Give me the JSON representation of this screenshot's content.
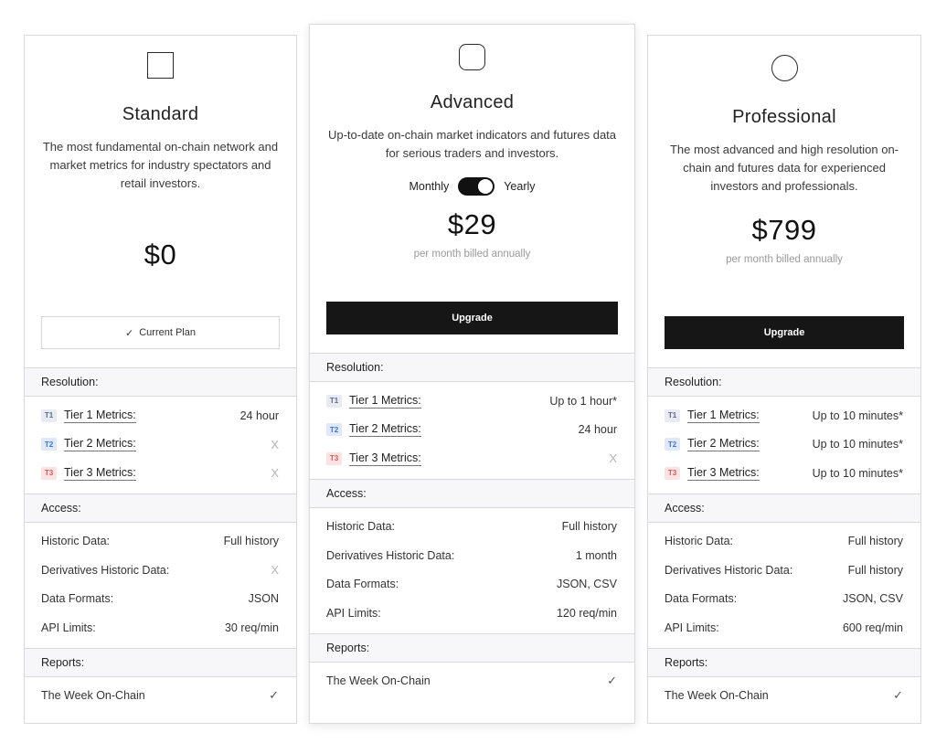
{
  "plans": [
    {
      "name": "Standard",
      "icon": "square-icon",
      "description": "The most fundamental on-chain network and market metrics for industry spectators and retail investors.",
      "price": "$0",
      "cta_check": "✓",
      "cta_label": "Current Plan",
      "resolution_label": "Resolution:",
      "tiers": [
        {
          "badge": "T1",
          "name": "Tier 1 Metrics:",
          "value": "24 hour"
        },
        {
          "badge": "T2",
          "name": "Tier 2 Metrics:",
          "value": "X"
        },
        {
          "badge": "T3",
          "name": "Tier 3 Metrics:",
          "value": "X"
        }
      ],
      "access_label": "Access:",
      "access": [
        {
          "name": "Historic Data:",
          "value": "Full history"
        },
        {
          "name": "Derivatives Historic Data:",
          "value": "X"
        },
        {
          "name": "Data Formats:",
          "value": "JSON"
        },
        {
          "name": "API Limits:",
          "value": "30 req/min"
        }
      ],
      "reports_label": "Reports:",
      "reports": [
        {
          "name": "The Week On-Chain",
          "value": "✓"
        }
      ]
    },
    {
      "name": "Advanced",
      "icon": "rounded-square-icon",
      "description": "Up-to-date on-chain market indicators and futures data for serious traders and investors.",
      "toggle_left": "Monthly",
      "toggle_right": "Yearly",
      "toggle_state": "Yearly",
      "price": "$29",
      "billing": "per month billed annually",
      "cta_label": "Upgrade",
      "resolution_label": "Resolution:",
      "tiers": [
        {
          "badge": "T1",
          "name": "Tier 1 Metrics:",
          "value": "Up to 1 hour*"
        },
        {
          "badge": "T2",
          "name": "Tier 2 Metrics:",
          "value": "24 hour"
        },
        {
          "badge": "T3",
          "name": "Tier 3 Metrics:",
          "value": "X"
        }
      ],
      "access_label": "Access:",
      "access": [
        {
          "name": "Historic Data:",
          "value": "Full history"
        },
        {
          "name": "Derivatives Historic Data:",
          "value": "1 month"
        },
        {
          "name": "Data Formats:",
          "value": "JSON, CSV"
        },
        {
          "name": "API Limits:",
          "value": "120 req/min"
        }
      ],
      "reports_label": "Reports:",
      "reports": [
        {
          "name": "The Week On-Chain",
          "value": "✓"
        }
      ]
    },
    {
      "name": "Professional",
      "icon": "circle-icon",
      "description": "The most advanced and high resolution on-chain and futures data for experienced investors and professionals.",
      "price": "$799",
      "billing": "per month billed annually",
      "cta_label": "Upgrade",
      "resolution_label": "Resolution:",
      "tiers": [
        {
          "badge": "T1",
          "name": "Tier 1 Metrics:",
          "value": "Up to 10 minutes*"
        },
        {
          "badge": "T2",
          "name": "Tier 2 Metrics:",
          "value": "Up to 10 minutes*"
        },
        {
          "badge": "T3",
          "name": "Tier 3 Metrics:",
          "value": "Up to 10 minutes*"
        }
      ],
      "access_label": "Access:",
      "access": [
        {
          "name": "Historic Data:",
          "value": "Full history"
        },
        {
          "name": "Derivatives Historic Data:",
          "value": "Full history"
        },
        {
          "name": "Data Formats:",
          "value": "JSON, CSV"
        },
        {
          "name": "API Limits:",
          "value": "600 req/min"
        }
      ],
      "reports_label": "Reports:",
      "reports": [
        {
          "name": "The Week On-Chain",
          "value": "✓"
        }
      ]
    }
  ]
}
